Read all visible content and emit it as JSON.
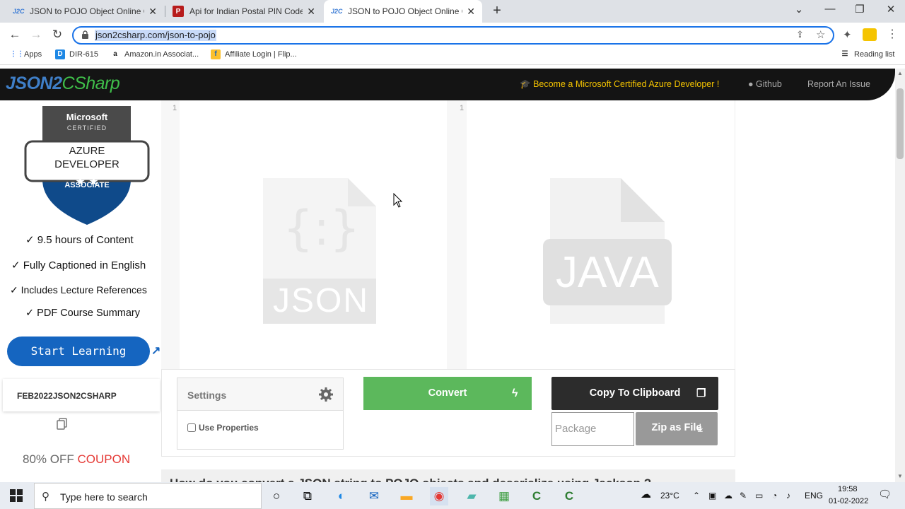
{
  "browser": {
    "tabs": [
      {
        "favicon": "J2C",
        "title": "JSON to POJO Object Online Co",
        "close": "✕"
      },
      {
        "favicon": "P",
        "title": "Api for Indian Postal PIN Code",
        "close": "✕"
      },
      {
        "favicon": "J2C",
        "title": "JSON to POJO Object Online Co",
        "close": "✕"
      }
    ],
    "new_tab": "+",
    "url": "json2csharp.com/json-to-pojo",
    "bookmarks": [
      {
        "icon": "apps-icon",
        "label": "Apps"
      },
      {
        "icon": "dir-icon",
        "label": "DIR-615"
      },
      {
        "icon": "amazon-icon",
        "label": "Amazon.in Associat..."
      },
      {
        "icon": "flipkart-icon",
        "label": "Affiliate Login | Flip..."
      }
    ],
    "reading_list": "Reading list"
  },
  "site": {
    "logo_part1": "JSON2",
    "logo_part2": "CSharp",
    "promo": "Become a Microsoft Certified Azure Developer !",
    "github": "Github",
    "report": "Report An Issue"
  },
  "sidebar": {
    "badge_top": "Microsoft",
    "badge_certified": "CERTIFIED",
    "badge_line1": "AZURE",
    "badge_line2": "DEVELOPER",
    "badge_associate": "ASSOCIATE",
    "features": [
      "✓ 9.5 hours of Content",
      "✓ Fully Captioned in English",
      "✓ Includes Lecture References",
      "✓ PDF Course Summary"
    ],
    "cta": "Start Learning",
    "coupon_code": "FEB2022JSON2CSHARP",
    "coupon_pct": "80% OFF",
    "coupon_word": "COUPON"
  },
  "editor": {
    "left_line": "1",
    "right_line": "1",
    "json_braces": "{:}",
    "json_label": "JSON",
    "java_label": "JAVA"
  },
  "controls": {
    "settings_label": "Settings",
    "use_properties": "Use Properties",
    "convert": "Convert",
    "copy": "Copy To Clipboard",
    "package_placeholder": "Package",
    "zip": "Zip as File"
  },
  "below_heading": "How do you convert a JSON string to POJO objects and deserialize using Jackson ?",
  "taskbar": {
    "search_placeholder": "Type here to search",
    "weather": "23°C",
    "lang": "ENG",
    "time": "19:58",
    "date": "01-02-2022"
  },
  "colors": {
    "accent_blue": "#1a73e8",
    "convert_green": "#5cb85c",
    "promo_yellow": "#f5c400",
    "start_blue": "#1565c0"
  }
}
